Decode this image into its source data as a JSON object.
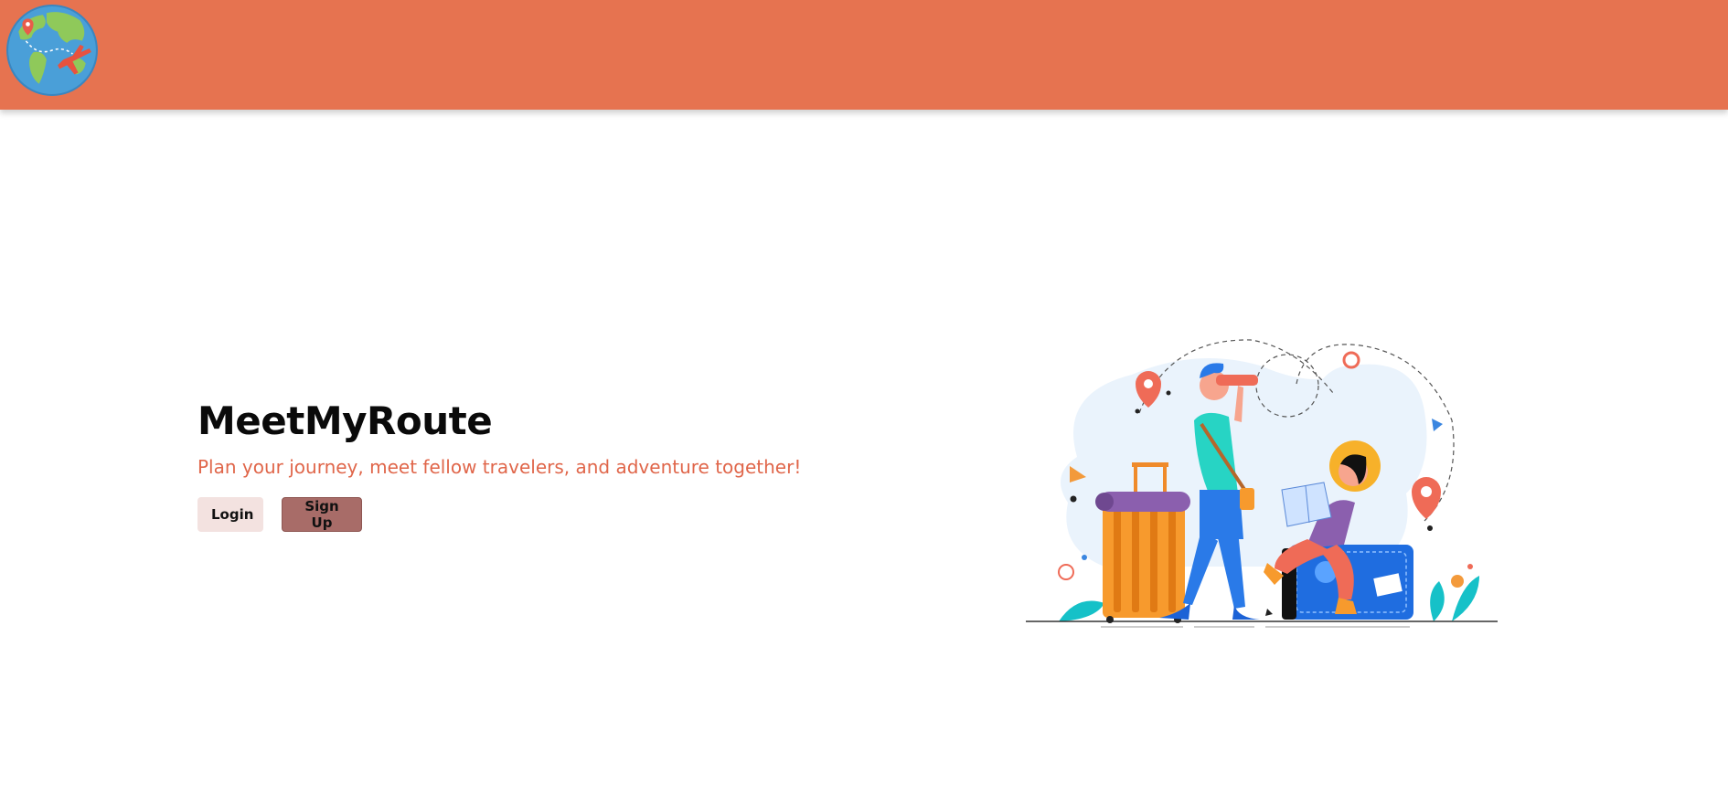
{
  "header": {
    "logo_icon": "globe-airplane-icon",
    "background_color": "#e67350"
  },
  "hero": {
    "title": "MeetMyRoute",
    "tagline": "Plan your journey, meet fellow travelers, and adventure together!",
    "tagline_color": "#e0664a"
  },
  "actions": {
    "login_label": "Login",
    "signup_label": "Sign Up",
    "login_color": "#f3e2e0",
    "signup_color": "#a86c68"
  },
  "illustration": {
    "icon": "travelers-illustration"
  }
}
